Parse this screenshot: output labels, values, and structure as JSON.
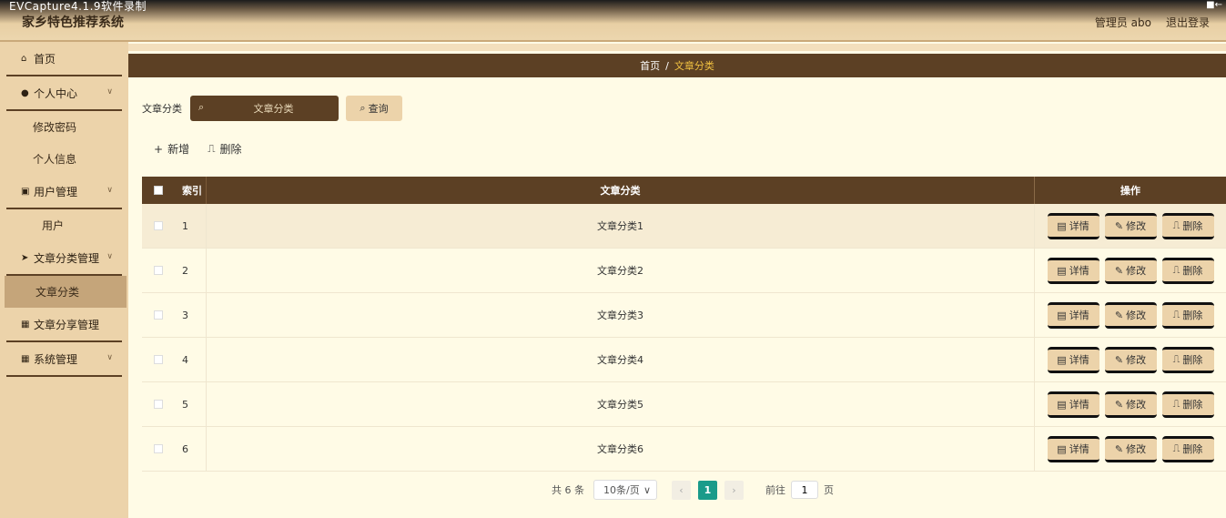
{
  "capture_title": "EVCapture4.1.9软件录制",
  "system_title": "家乡特色推荐系统",
  "header": {
    "admin": "管理员 abo",
    "logout": "退出登录"
  },
  "sidebar": {
    "home": "首页",
    "personal_center": "个人中心",
    "change_password": "修改密码",
    "personal_info": "个人信息",
    "user_management": "用户管理",
    "users": "用户",
    "article_category_management": "文章分类管理",
    "article_category": "文章分类",
    "article_share": "文章分享管理",
    "system_management": "系统管理"
  },
  "breadcrumb": {
    "home": "首页",
    "separator": "/",
    "current": "文章分类"
  },
  "search": {
    "label": "文章分类",
    "placeholder": "文章分类",
    "query_button": "查询"
  },
  "actions": {
    "add": "新增",
    "delete": "删除"
  },
  "table": {
    "headers": {
      "index": "索引",
      "name": "文章分类",
      "ops": "操作"
    },
    "rows": [
      {
        "index": "1",
        "name": "文章分类1"
      },
      {
        "index": "2",
        "name": "文章分类2"
      },
      {
        "index": "3",
        "name": "文章分类3"
      },
      {
        "index": "4",
        "name": "文章分类4"
      },
      {
        "index": "5",
        "name": "文章分类5"
      },
      {
        "index": "6",
        "name": "文章分类6"
      }
    ],
    "row_buttons": {
      "detail": "详情",
      "edit": "修改",
      "delete": "删除"
    }
  },
  "pagination": {
    "total": "共 6 条",
    "page_size": "10条/页",
    "current_page": "1",
    "goto_label": "前往",
    "goto_value": "1",
    "page_unit": "页"
  },
  "colors": {
    "dark_brown": "#5c4024",
    "tan": "#ecd3aa",
    "cream": "#fffbe6",
    "accent_gold": "#f0c040",
    "page_teal": "#1a9b8a"
  }
}
